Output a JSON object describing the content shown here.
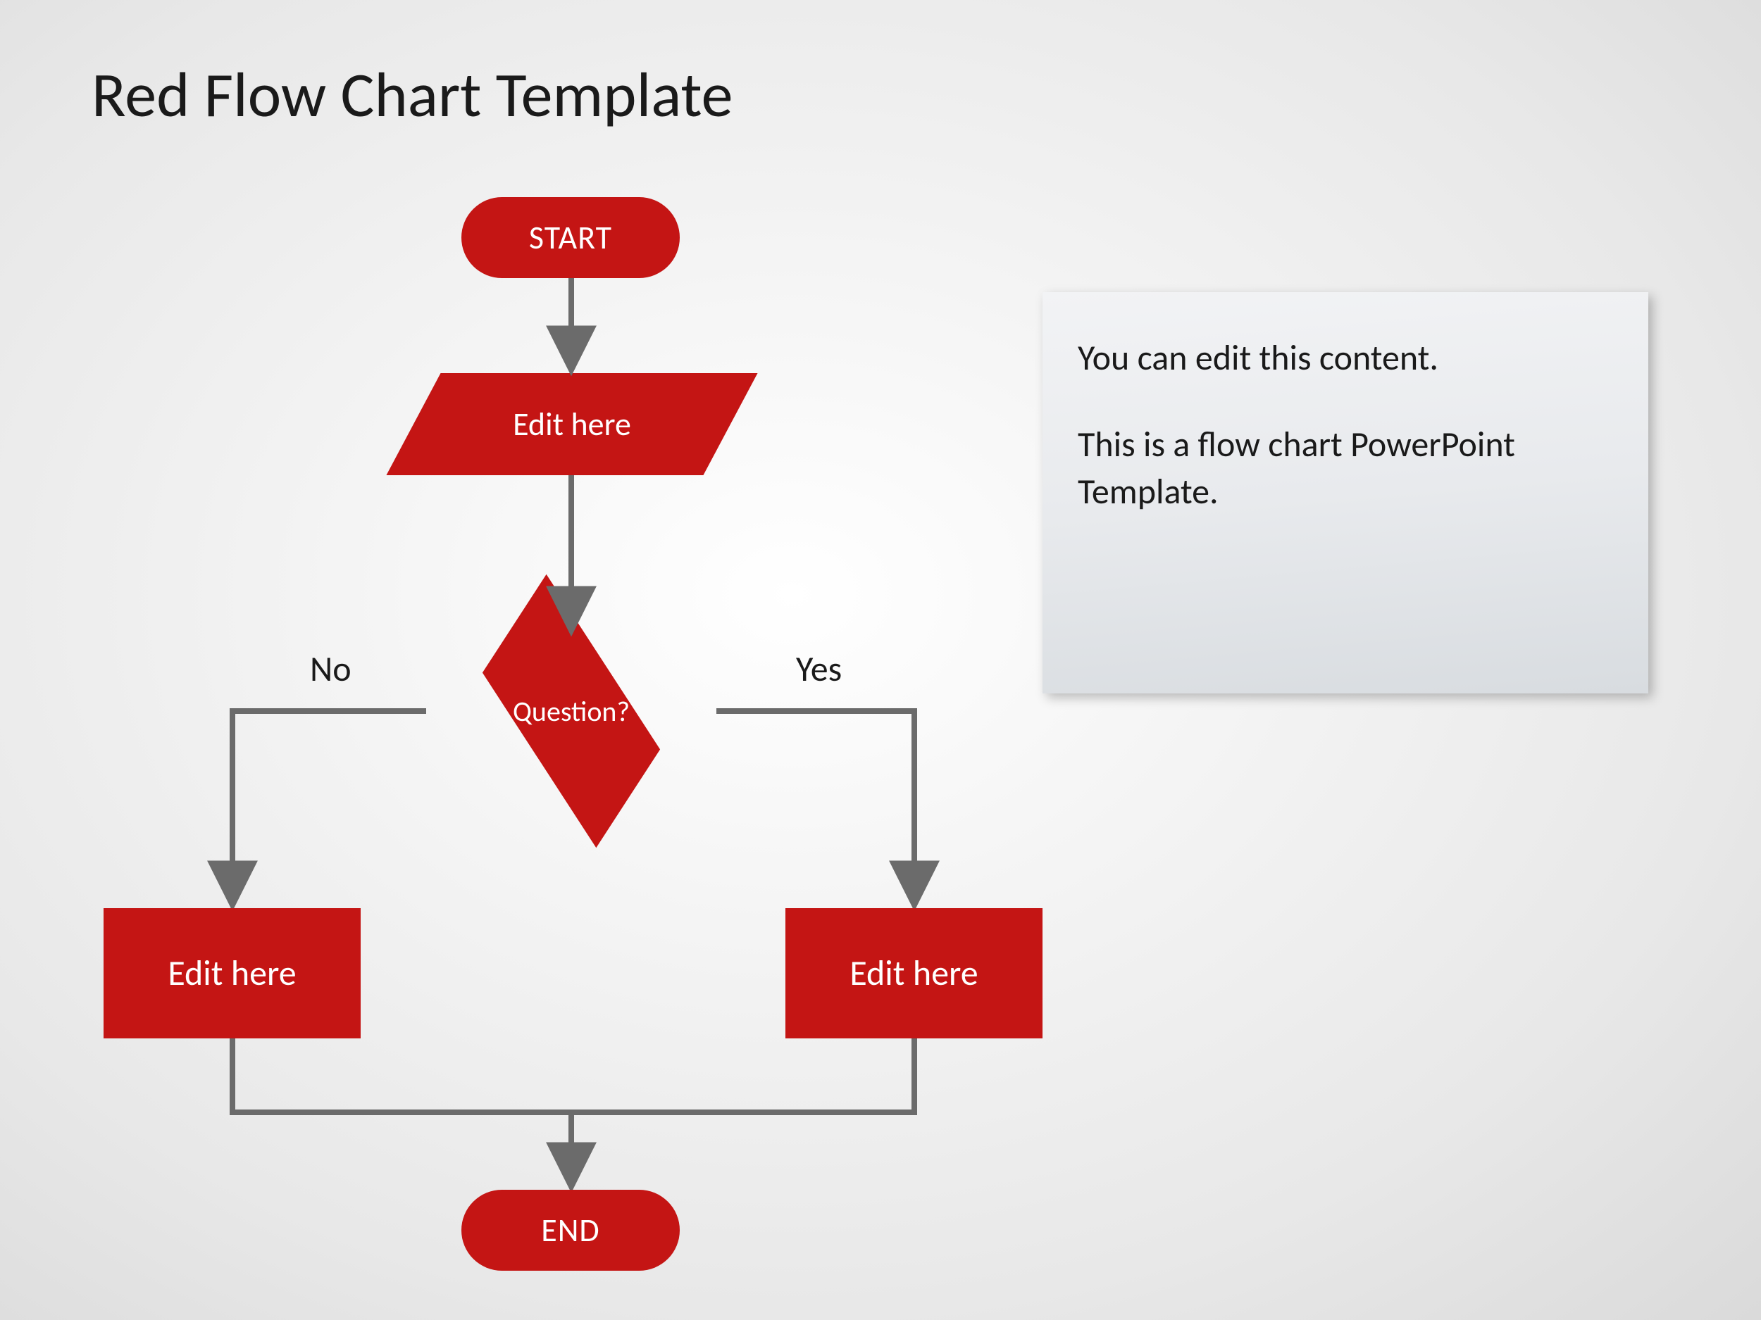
{
  "title": "Red Flow Chart Template",
  "sidebox": {
    "line1": "You can edit this content.",
    "line2": "This is a flow chart PowerPoint Template."
  },
  "nodes": {
    "start": "START",
    "process_top": "Edit here",
    "decision": "Question?",
    "branch_no": "No",
    "branch_yes": "Yes",
    "process_left": "Edit here",
    "process_right": "Edit here",
    "end": "END"
  },
  "colors": {
    "shape_fill": "#c41514",
    "connector": "#6b6b6b",
    "text_dark": "#1a1a1a"
  }
}
